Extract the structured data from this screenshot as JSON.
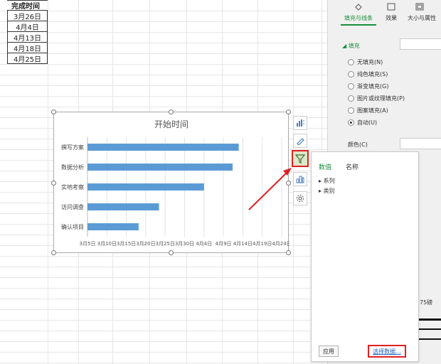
{
  "sheet": {
    "header": "完成时间",
    "dates": [
      "3月26日",
      "4月4日",
      "4月13日",
      "4月18日",
      "4月25日"
    ]
  },
  "chart_data": {
    "type": "bar",
    "title": "开始时间",
    "categories": [
      "撰写方案",
      "数据分析",
      "实地考察",
      "访问调查",
      "确认项目"
    ],
    "values": [
      74,
      71,
      57,
      35,
      25
    ],
    "xlim": [
      0,
      95
    ],
    "tick_labels": [
      "3月5日",
      "3月10日",
      "3月15日",
      "3月20日",
      "3月25日",
      "3月30日",
      "4月4日",
      "4月9日",
      "4月14日",
      "4月19日",
      "4月24日"
    ],
    "bar_color": "#5b9bd5",
    "grid": true
  },
  "right_pane": {
    "tabs": [
      "填充与线条",
      "效果",
      "大小与属性"
    ],
    "section": "填充",
    "fill_options": [
      "无填充(N)",
      "纯色填充(S)",
      "渐变填充(G)",
      "图片或纹理填充(P)",
      "图案填充(A)",
      "自动(U)"
    ],
    "selected_fill": "自动(U)",
    "color_label": "颜色(C)",
    "partial_text": "75磅"
  },
  "popup": {
    "tab_values": "数值",
    "tab_names": "名称",
    "items": [
      "系列",
      "类别"
    ],
    "apply_label": "应用",
    "select_data_label": "选择数据..."
  },
  "colors": {
    "accent_red": "#e02020",
    "accent_green": "#1a8f3c"
  }
}
